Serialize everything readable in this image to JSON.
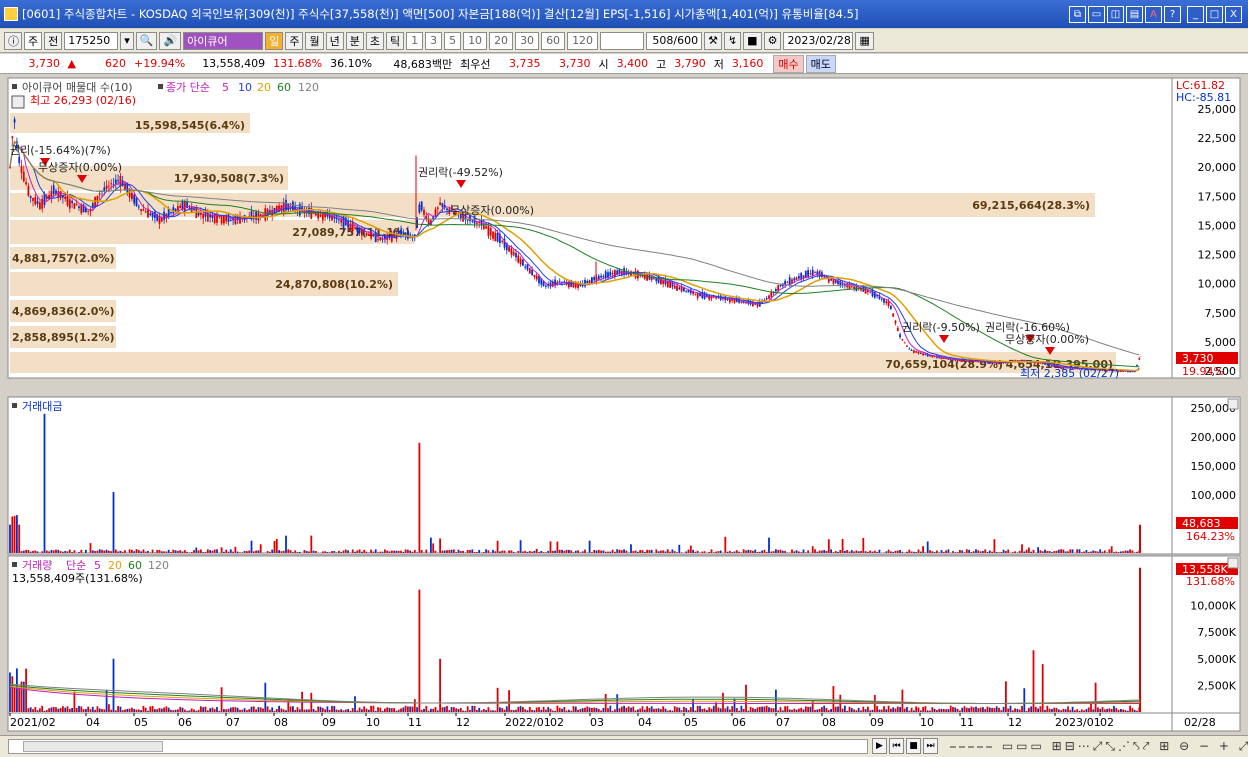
{
  "window": {
    "title": "[0601] 주식종합차트 - KOSDAQ 외국인보유[309(천)] 주식수[37,558(천)] 액면[500] 자본금[188(억)] 결산[12월] EPS[-1,516] 시가총액[1,401(억)] 유통비율[84.5]",
    "btn_min": "_",
    "btn_max": "□",
    "btn_close": "X"
  },
  "toolbar": {
    "mode": "주",
    "jeon": "전",
    "code": "175250",
    "name": "아이큐어",
    "periods": [
      "일",
      "주",
      "월",
      "년",
      "분",
      "초",
      "틱"
    ],
    "numbers": [
      "1",
      "3",
      "5",
      "10",
      "20",
      "30",
      "60",
      "120"
    ],
    "count": "508",
    "max": "/600",
    "date": "2023/02/28"
  },
  "pricebar": {
    "price": "3,730",
    "change": "620",
    "rate": "+19.94%",
    "volume": "13,558,409",
    "vol_rate": "131.68%",
    "turnover": "36.10%",
    "amount": "48,683백만",
    "quote_label": "최우선",
    "ask": "3,735",
    "bid": "3,730",
    "open_label": "시",
    "open": "3,400",
    "high_label": "고",
    "high": "3,790",
    "low_label": "저",
    "low": "3,160",
    "buy": "매수",
    "sell": "매도"
  },
  "colors": {
    "up": "#e00000",
    "down": "#0030d0",
    "ma5": "#c020c0",
    "ma10": "#2040e0",
    "ma20": "#e0a000",
    "ma60": "#208020",
    "ma120": "#808080",
    "band": "#f2dcc0"
  },
  "panel1": {
    "legend_title": "아이큐어 매물대 수(10)",
    "legend_ma": "종가 단순",
    "mas": [
      "5",
      "10",
      "20",
      "60",
      "120"
    ],
    "high_label": "최고 26,293 (02/16)",
    "low_label": "최저 2,385 (02/27)",
    "lc": "LC:61.82",
    "hc": "HC:-85.81",
    "price_tag": "3,730",
    "price_rate": "19.94%",
    "yaxis": [
      "25,000",
      "22,500",
      "20,000",
      "17,500",
      "15,000",
      "12,500",
      "10,000",
      "7,500",
      "5,000",
      "2,500"
    ],
    "bands": [
      {
        "label": "15,598,545(6.4%)"
      },
      {
        "label": "17,930,508(7.3%)"
      },
      {
        "label": "69,215,664(28.3%)"
      },
      {
        "label": "27,089,757(11.1%)"
      },
      {
        "label": "4,881,757(2.0%)"
      },
      {
        "label": "24,870,808(10.2%)"
      },
      {
        "label": "4,869,836(2.0%)"
      },
      {
        "label": "2,858,895(1.2%)"
      },
      {
        "label": "70,659,104(28.9%)"
      },
      {
        "label": "4,654,10"
      },
      {
        "label": "2,395.00)"
      }
    ],
    "events": [
      {
        "label": "권리(-15.64%)(7%)"
      },
      {
        "label": "무상증자(0.00%)"
      },
      {
        "label": "권리락(-49.52%)"
      },
      {
        "label": "무상증자(0.00%)"
      },
      {
        "label": "권리락(-9.50%)"
      },
      {
        "label": "권리락(-16.60%)"
      },
      {
        "label": "무상증자(0.00%)"
      }
    ]
  },
  "panel2": {
    "title": "거래대금",
    "yaxis": [
      "250,000",
      "200,000",
      "150,000",
      "100,000",
      "50,000"
    ],
    "tag": "48,683",
    "tag_rate": "164.23%"
  },
  "panel3": {
    "title": "거래량",
    "legend_ma": "단순",
    "mas": [
      "5",
      "20",
      "60",
      "120"
    ],
    "sub": "13,558,409주(131.68%)",
    "yaxis": [
      "10,000K",
      "7,500K",
      "5,000K",
      "2,500K"
    ],
    "tag": "13,558K",
    "tag_rate": "131.68%"
  },
  "xaxis": [
    "2021/02",
    "04",
    "05",
    "06",
    "07",
    "08",
    "09",
    "10",
    "11",
    "12",
    "2022/01",
    "02",
    "03",
    "04",
    "05",
    "06",
    "07",
    "08",
    "09",
    "10",
    "11",
    "12",
    "2023/01",
    "02"
  ],
  "xaxis_right": "02/28"
}
